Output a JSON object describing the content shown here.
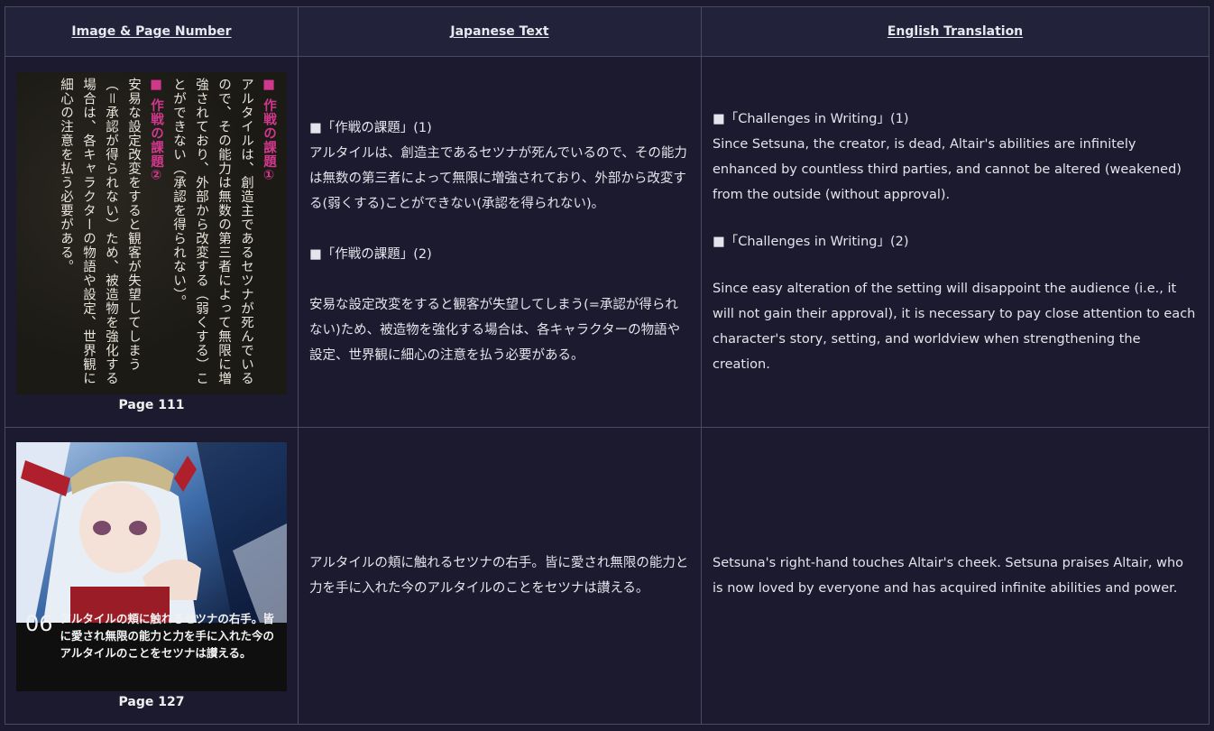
{
  "headers": {
    "col1": "Image & Page Number",
    "col2": "Japanese Text",
    "col3": "English Translation"
  },
  "rows": [
    {
      "caption": "Page 111",
      "scan": {
        "heading1": "■ 作戦の課題①",
        "body1": "アルタイルは、創造主であるセツナが死んでいるので、その能力は無数の第三者によって無限に増強されており、外部から改変する（弱くする）ことができない（承認を得られない）。",
        "heading2": "■ 作戦の課題②",
        "body2": "安易な設定改変をすると観客が失望してしまう（＝承認が得られない）ため、被造物を強化する場合は、各キャラクターの物語や設定、世界観に細心の注意を払う必要がある。"
      },
      "jp": {
        "p1_head": "■「作戦の課題」(1)",
        "p1_body": "アルタイルは、創造主であるセツナが死んでいるので、その能力は無数の第三者によって無限に増強されており、外部から改変する(弱くする)ことができない(承認を得られない)。",
        "p2_head": "■「作戦の課題」(2)",
        "p2_body": "安易な設定改変をすると観客が失望してしまう(=承認が得られない)ため、被造物を強化する場合は、各キャラクターの物語や設定、世界観に細心の注意を払う必要がある。"
      },
      "en": {
        "p1_head": "■「Challenges in Writing」(1)",
        "p1_body": "Since Setsuna, the creator, is dead, Altair's abilities are infinitely enhanced by countless third parties, and cannot be altered (weakened) from the outside (without approval).",
        "p2_head": "■「Challenges in Writing」(2)",
        "p2_body": "Since easy alteration of the setting will disappoint the audience (i.e., it will not gain their approval), it is necessary to pay close attention to each character's story, setting, and worldview when strengthening the creation."
      }
    },
    {
      "caption": "Page 127",
      "scan": {
        "number": "06",
        "text": "アルタイルの頬に触れるセツナの右手。皆に愛され無限の能力と力を手に入れた今のアルタイルのことをセツナは讃える。"
      },
      "jp": {
        "body": "アルタイルの頬に触れるセツナの右手。皆に愛され無限の能力と力を手に入れた今のアルタイルのことをセツナは讃える。"
      },
      "en": {
        "body": "Setsuna's right-hand touches Altair's cheek. Setsuna praises Altair, who is now loved by everyone and has acquired infinite abilities and power."
      }
    }
  ]
}
